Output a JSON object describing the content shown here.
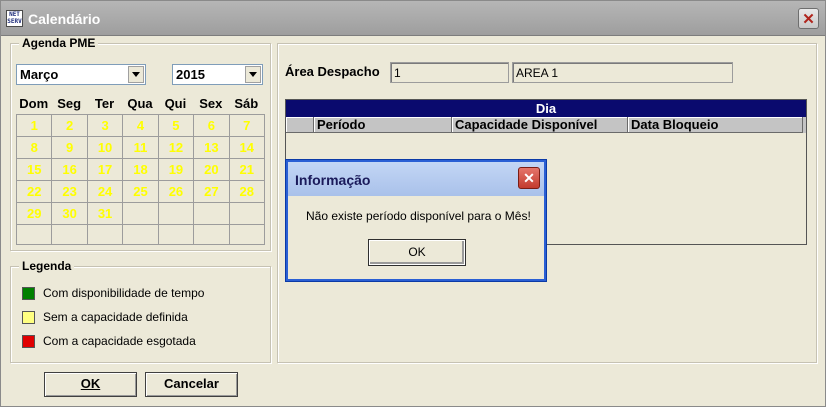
{
  "window": {
    "title": "Calendário",
    "icon_text": "NET SERV"
  },
  "agenda": {
    "legend": "Agenda PME",
    "month": "Março",
    "year": "2015",
    "weekdays": [
      "Dom",
      "Seg",
      "Ter",
      "Qua",
      "Qui",
      "Sex",
      "Sáb"
    ],
    "days": [
      "1",
      "2",
      "3",
      "4",
      "5",
      "6",
      "7",
      "8",
      "9",
      "10",
      "11",
      "12",
      "13",
      "14",
      "15",
      "16",
      "17",
      "18",
      "19",
      "20",
      "21",
      "22",
      "23",
      "24",
      "25",
      "26",
      "27",
      "28",
      "29",
      "30",
      "31",
      "",
      "",
      "",
      "",
      "",
      "",
      "",
      "",
      "",
      "",
      ""
    ]
  },
  "legenda": {
    "legend": "Legenda",
    "items": [
      {
        "label": "Com disponibilidade de tempo",
        "color": "#008000"
      },
      {
        "label": "Sem a capacidade definida",
        "color": "#ffff80"
      },
      {
        "label": "Com a capacidade esgotada",
        "color": "#e00000"
      }
    ]
  },
  "buttons": {
    "ok": "OK",
    "cancel": "Cancelar"
  },
  "despacho": {
    "label": "Área Despacho",
    "code": "1",
    "name": "AREA 1"
  },
  "grid": {
    "title": "Dia",
    "columns": [
      "Período",
      "Capacidade Disponível",
      "Data Bloqueio"
    ]
  },
  "dialog": {
    "title": "Informação",
    "message": "Não existe período disponível para o Mês!",
    "ok": "OK"
  },
  "colors": {
    "day_text": "#ffff00",
    "grid_header": "#0a0a6e"
  }
}
